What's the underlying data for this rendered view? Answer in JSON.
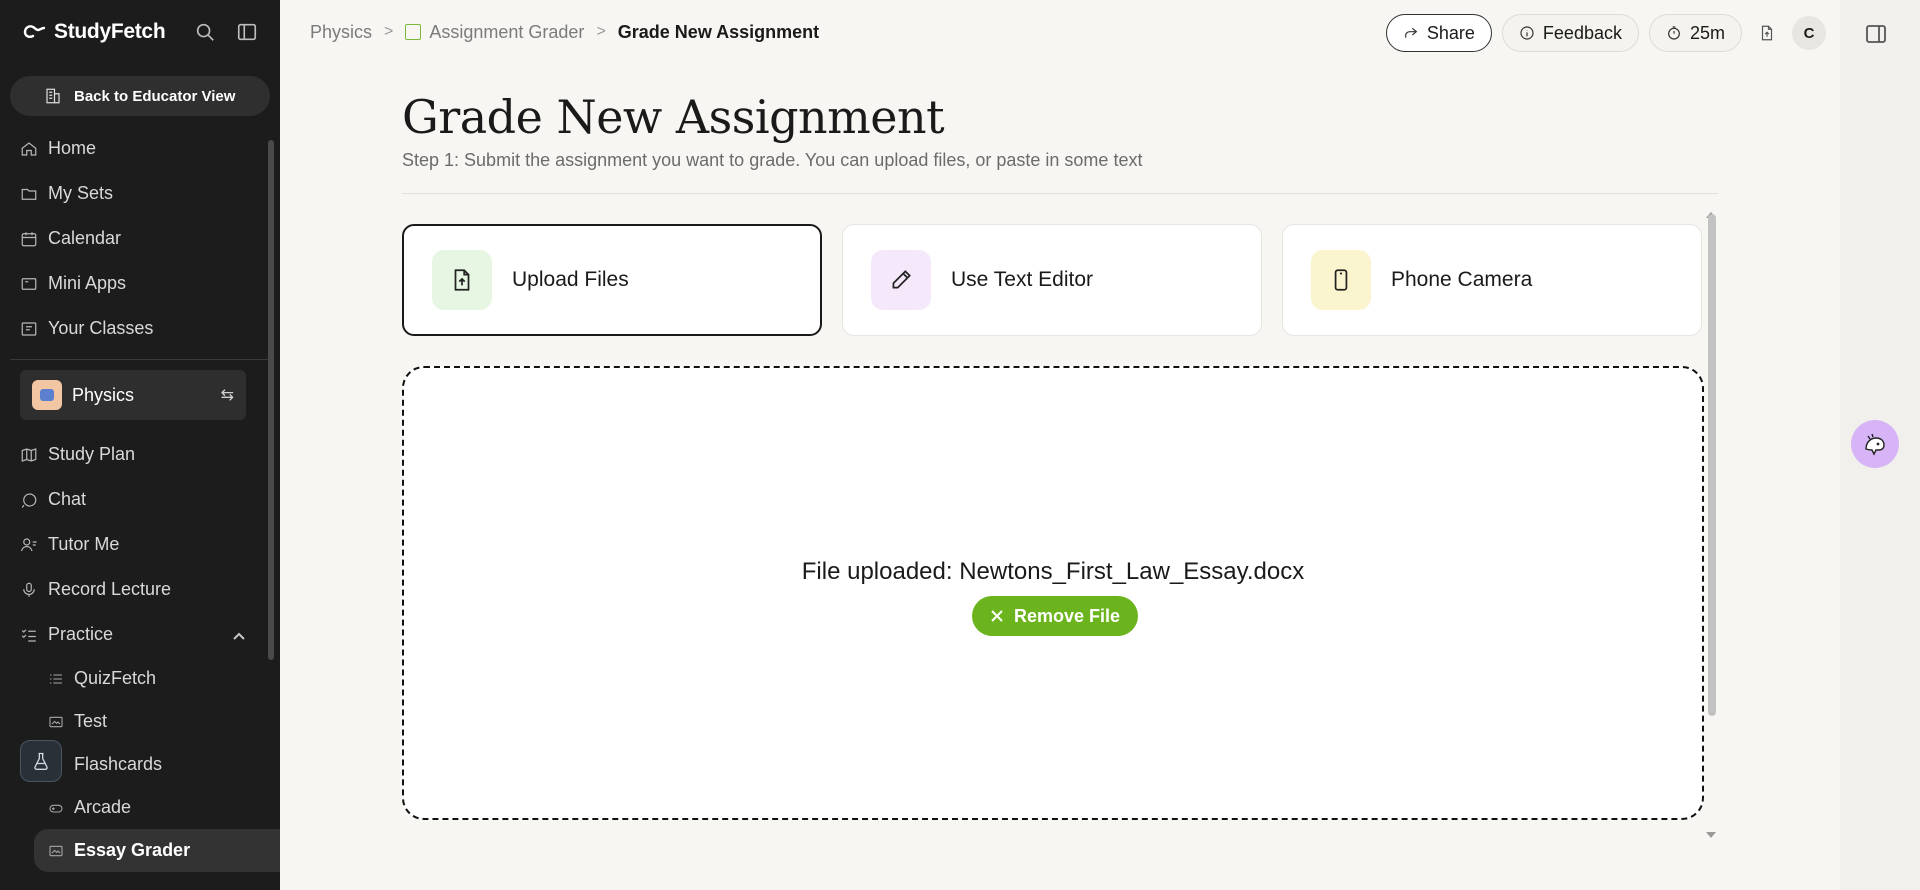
{
  "app": {
    "name": "StudyFetch"
  },
  "sidebar": {
    "back_label": "Back to Educator View",
    "items": [
      {
        "label": "Home",
        "icon": "home-icon"
      },
      {
        "label": "My Sets",
        "icon": "folder-icon"
      },
      {
        "label": "Calendar",
        "icon": "calendar-icon"
      },
      {
        "label": "Mini Apps",
        "icon": "apps-icon"
      },
      {
        "label": "Your Classes",
        "icon": "classes-icon"
      }
    ],
    "class_name": "Physics",
    "class_items": [
      {
        "label": "Study Plan",
        "icon": "map-icon"
      },
      {
        "label": "Chat",
        "icon": "chat-icon"
      },
      {
        "label": "Tutor Me",
        "icon": "tutor-icon"
      },
      {
        "label": "Record Lecture",
        "icon": "mic-icon"
      },
      {
        "label": "Practice",
        "icon": "practice-icon"
      }
    ],
    "practice_items": [
      {
        "label": "QuizFetch"
      },
      {
        "label": "Test"
      },
      {
        "label": "Flashcards"
      },
      {
        "label": "Arcade"
      },
      {
        "label": "Essay Grader"
      }
    ]
  },
  "breadcrumb": {
    "root": "Physics",
    "parent": "Assignment Grader",
    "current": "Grade New Assignment"
  },
  "toolbar": {
    "share_label": "Share",
    "feedback_label": "Feedback",
    "timer": "25m",
    "avatar_initial": "C"
  },
  "page": {
    "title": "Grade New Assignment",
    "subtitle": "Step 1: Submit the assignment you want to grade. You can upload files, or paste in some text"
  },
  "options": [
    {
      "label": "Upload Files",
      "icon": "upload-file-icon",
      "color": "#e6f6e2",
      "selected": true
    },
    {
      "label": "Use Text Editor",
      "icon": "pencil-icon",
      "color": "#f6e8fb",
      "selected": false
    },
    {
      "label": "Phone Camera",
      "icon": "phone-icon",
      "color": "#fbf5cf",
      "selected": false
    }
  ],
  "upload": {
    "message": "File uploaded: Newtons_First_Law_Essay.docx",
    "remove_label": "Remove File"
  },
  "colors": {
    "accent": "#6cb41e",
    "sidebar_bg": "#1c1c1c"
  }
}
